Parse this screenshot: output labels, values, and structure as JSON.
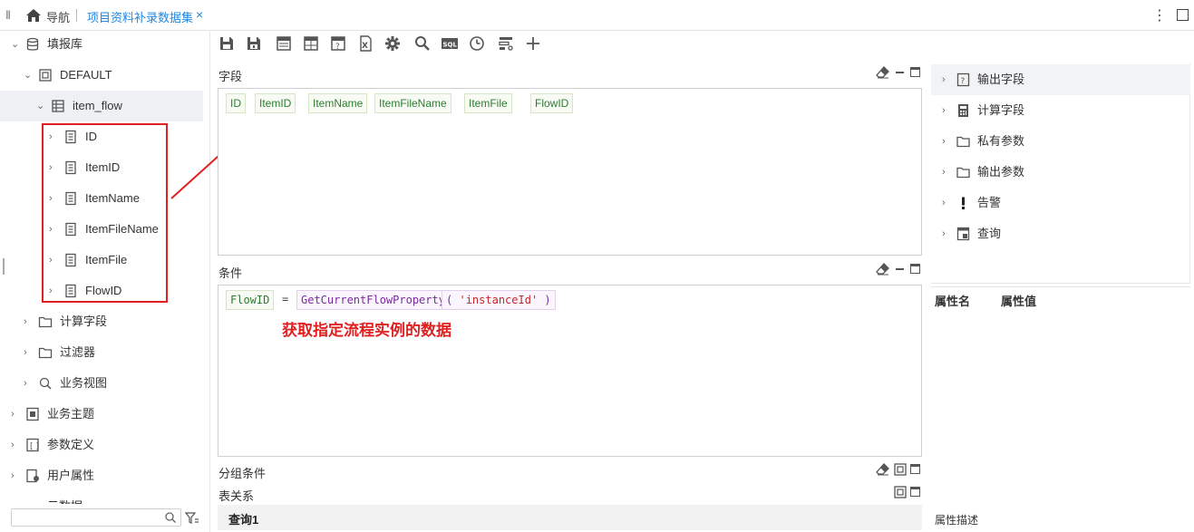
{
  "topbar": {
    "nav_label": "导航",
    "tab_title": "项目资料补录数据集",
    "tab_close": "×"
  },
  "tree": {
    "root": "填报库",
    "schema": "DEFAULT",
    "table": "item_flow",
    "fields": [
      "ID",
      "ItemID",
      "ItemName",
      "ItemFileName",
      "ItemFile",
      "FlowID"
    ],
    "table_children": [
      "计算字段",
      "过滤器",
      "业务视图"
    ],
    "root_siblings": [
      "业务主题",
      "参数定义",
      "用户属性",
      "元数据"
    ]
  },
  "sections": {
    "fields_title": "字段",
    "conditions_title": "条件",
    "group_title": "分组条件",
    "relation_title": "表关系"
  },
  "field_chips": [
    "ID",
    "ItemID",
    "ItemName",
    "ItemFileName",
    "ItemFile",
    "FlowID"
  ],
  "condition": {
    "field": "FlowID",
    "op": "=",
    "func": "GetCurrentFlowProperty",
    "lparen": "(",
    "arg": "'instanceId'",
    "rparen": ")"
  },
  "annotation": "获取指定流程实例的数据",
  "query_tab": "查询1",
  "right_panel": {
    "items": [
      "输出字段",
      "计算字段",
      "私有参数",
      "输出参数",
      "告警",
      "查询"
    ],
    "prop_name_header": "属性名",
    "prop_value_header": "属性值",
    "prop_desc": "属性描述"
  }
}
